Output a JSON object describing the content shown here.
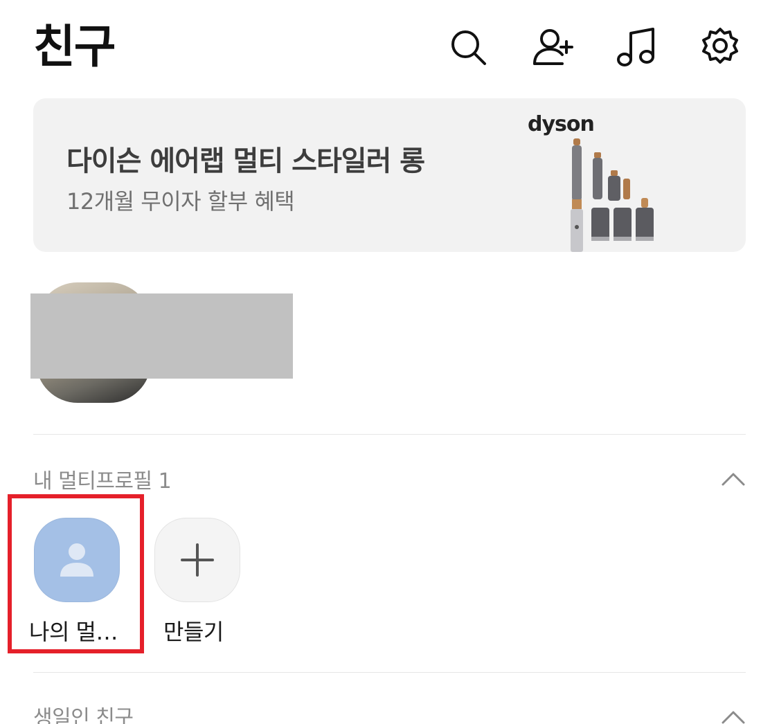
{
  "header": {
    "title": "친구",
    "icons": [
      "search-icon",
      "add-friend-icon",
      "music-icon",
      "settings-icon"
    ]
  },
  "ad": {
    "title": "다이슨 에어랩 멀티 스타일러 롱",
    "subtitle": "12개월 무이자 할부 혜택",
    "brand": "dyson"
  },
  "multi_profile": {
    "section_label": "내 멀티프로필 1",
    "items": [
      {
        "label": "나의 멀…"
      },
      {
        "label": "만들기"
      }
    ]
  },
  "birthday": {
    "section_label": "생일인 친구"
  },
  "colors": {
    "highlight": "#e5202a",
    "avatar_blue": "#a4c0e6",
    "banner_bg": "#f2f2f2"
  }
}
